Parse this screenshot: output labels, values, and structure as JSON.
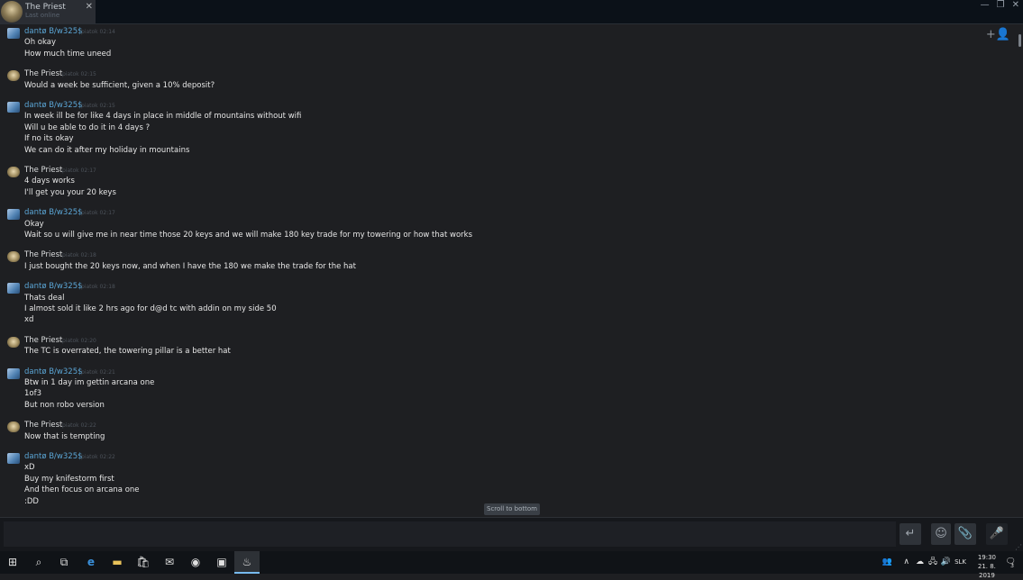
{
  "window": {
    "tab_name": "The Priest",
    "tab_status": "Last online",
    "tab_close": "✕",
    "controls": [
      "—",
      "❐",
      "✕"
    ]
  },
  "chat": {
    "add_friend_icon": "+👤",
    "messages": [
      {
        "sender": "dantø B/w325$",
        "type": "dante",
        "time": "piatok 02:14",
        "lines": [
          "Oh okay",
          "How much time uneed"
        ]
      },
      {
        "sender": "The Priest",
        "type": "priest",
        "time": "piatok 02:15",
        "lines": [
          "Would a week be sufficient, given a 10% deposit?"
        ]
      },
      {
        "sender": "dantø B/w325$",
        "type": "dante",
        "time": "piatok 02:15",
        "lines": [
          "In week ill be for like 4 days in place in middle of mountains without wifi",
          "Will u be able to do it in 4 days ?",
          "If no its okay",
          "We can do it after my holiday in mountains"
        ]
      },
      {
        "sender": "The Priest",
        "type": "priest",
        "time": "piatok 02:17",
        "lines": [
          "4 days works",
          "I'll get you your 20 keys"
        ]
      },
      {
        "sender": "dantø B/w325$",
        "type": "dante",
        "time": "piatok 02:17",
        "lines": [
          "Okay",
          "Wait so u will give me in near time those 20 keys and we will make 180 key trade for my towering or how that works"
        ]
      },
      {
        "sender": "The Priest",
        "type": "priest",
        "time": "piatok 02:18",
        "lines": [
          "I just bought the 20 keys now, and when I have the 180 we make the trade for the hat"
        ]
      },
      {
        "sender": "dantø B/w325$",
        "type": "dante",
        "time": "piatok 02:18",
        "lines": [
          "Thats deal",
          "I almost sold it like 2 hrs ago for d@d tc with addin on my side 50",
          "xd"
        ]
      },
      {
        "sender": "The Priest",
        "type": "priest",
        "time": "piatok 02:20",
        "lines": [
          "The TC is overrated, the towering pillar is a better hat"
        ]
      },
      {
        "sender": "dantø B/w325$",
        "type": "dante",
        "time": "piatok 02:21",
        "lines": [
          "Btw in 1 day im gettin arcana one",
          "1of3",
          "But non robo version"
        ]
      },
      {
        "sender": "The Priest",
        "type": "priest",
        "time": "piatok 02:22",
        "lines": [
          "Now that is tempting"
        ]
      },
      {
        "sender": "dantø B/w325$",
        "type": "dante",
        "time": "piatok 02:22",
        "lines": [
          "xD",
          "Buy my knifestorm first",
          "And then focus on arcana one",
          ":DD"
        ]
      }
    ],
    "scroll_to_bottom": "Scroll to bottom"
  },
  "input": {
    "placeholder": "",
    "send_icon": "↵",
    "emoji_icon": "☺",
    "attach_icon": "📎",
    "voice_icon": "🎤"
  },
  "taskbar": {
    "start_icon": "⊞",
    "search_icon": "⌕",
    "taskview_icon": "⧉",
    "edge_icon": "e",
    "explorer_icon": "▬",
    "store_icon": "🛍",
    "mail_icon": "✉",
    "chrome_icon": "◉",
    "app_icon": "▣",
    "steam_icon": "♨",
    "people_icon": "👥",
    "chevron_icon": "∧",
    "cloud_icon": "☁",
    "network_icon": "🖧",
    "volume_icon": "🔊",
    "lang": "SLK",
    "time": "19:30",
    "date": "21. 8. 2019",
    "notif_icon": "🗨",
    "notif_count": "3"
  }
}
